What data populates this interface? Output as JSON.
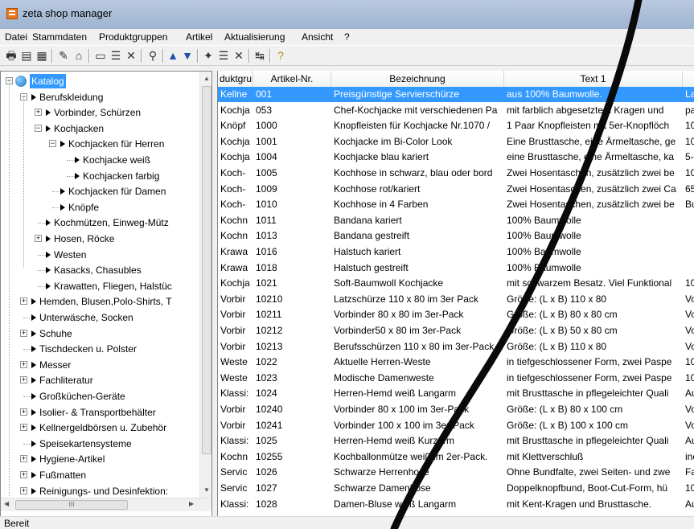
{
  "window": {
    "title": "zeta shop manager"
  },
  "menu": [
    "Datei",
    "Stammdaten",
    "Produktgruppen",
    "Artikel",
    "Aktualisierung",
    "Ansicht",
    "?"
  ],
  "toolbar_icons": [
    "print-icon",
    "print-preview-icon",
    "document-icon",
    "tool-icon",
    "lock-icon",
    "folder-new-icon",
    "properties-icon",
    "delete-icon",
    "binoculars-icon",
    "arrow-up-icon",
    "arrow-down-icon",
    "new-item-icon",
    "properties-icon",
    "delete-icon",
    "sort-icon",
    "help-icon"
  ],
  "tree": [
    {
      "label": "Katalog",
      "level": 0,
      "expander": "minus",
      "selected": true,
      "icon": "katalog"
    },
    {
      "label": "Berufskleidung",
      "level": 1,
      "expander": "minus"
    },
    {
      "label": "Vorbinder, Schürzen",
      "level": 2,
      "expander": "plus"
    },
    {
      "label": "Kochjacken",
      "level": 2,
      "expander": "minus"
    },
    {
      "label": "Kochjacken für Herren",
      "level": 3,
      "expander": "minus"
    },
    {
      "label": "Kochjacke weiß",
      "level": 4,
      "expander": "none"
    },
    {
      "label": "Kochjacken farbig",
      "level": 4,
      "expander": "none"
    },
    {
      "label": "Kochjacken für Damen",
      "level": 3,
      "expander": "none"
    },
    {
      "label": "Knöpfe",
      "level": 3,
      "expander": "none"
    },
    {
      "label": "Kochmützen, Einweg-Mütz",
      "level": 2,
      "expander": "none"
    },
    {
      "label": "Hosen, Röcke",
      "level": 2,
      "expander": "plus"
    },
    {
      "label": "Westen",
      "level": 2,
      "expander": "none"
    },
    {
      "label": "Kasacks, Chasubles",
      "level": 2,
      "expander": "none"
    },
    {
      "label": "Krawatten, Fliegen, Halstüc",
      "level": 2,
      "expander": "none"
    },
    {
      "label": "Hemden, Blusen,Polo-Shirts, T",
      "level": 1,
      "expander": "plus"
    },
    {
      "label": "Unterwäsche, Socken",
      "level": 1,
      "expander": "none"
    },
    {
      "label": "Schuhe",
      "level": 1,
      "expander": "plus"
    },
    {
      "label": "Tischdecken u. Polster",
      "level": 1,
      "expander": "none"
    },
    {
      "label": "Messer",
      "level": 1,
      "expander": "plus"
    },
    {
      "label": "Fachliteratur",
      "level": 1,
      "expander": "plus"
    },
    {
      "label": "Großküchen-Geräte",
      "level": 1,
      "expander": "none"
    },
    {
      "label": "Isolier- & Transportbehälter",
      "level": 1,
      "expander": "plus"
    },
    {
      "label": "Kellnergeldbörsen u. Zubehör",
      "level": 1,
      "expander": "plus"
    },
    {
      "label": "Speisekartensysteme",
      "level": 1,
      "expander": "none"
    },
    {
      "label": "Hygiene-Artikel",
      "level": 1,
      "expander": "plus"
    },
    {
      "label": "Fußmatten",
      "level": 1,
      "expander": "plus"
    },
    {
      "label": "Reinigungs- und Desinfektion:",
      "level": 1,
      "expander": "plus"
    }
  ],
  "tree_hscroll_grip": "III",
  "grid": {
    "columns": [
      "duktgru",
      "Artikel-Nr.",
      "Bezeichnung",
      "Text 1"
    ],
    "rows": [
      [
        "Kellne",
        "001",
        "Preisgünstige Servierschürze",
        "aus 100% Baumwolle.",
        "La"
      ],
      [
        "Kochja",
        "053",
        "Chef-Kochjacke mit verschiedenen Pa",
        "mit farblich abgesetztem Kragen und",
        "pa"
      ],
      [
        "Knöpf",
        "1000",
        "Knopfleisten für Kochjacke Nr.1070 /",
        "1 Paar Knopfleisten mit 5er-Knopflöch",
        "10"
      ],
      [
        "Kochja",
        "1001",
        "Kochjacke im Bi-Color Look",
        "Eine Brusttasche, eine Ärmeltasche, ge",
        "10"
      ],
      [
        "Kochja",
        "1004",
        "Kochjacke blau kariert",
        "eine Brusttasche, eine Ärmeltasche, ka",
        "5-"
      ],
      [
        "Koch-",
        "1005",
        "Kochhose in schwarz, blau oder bord",
        "Zwei Hosentaschen, zusätzlich zwei be",
        "10"
      ],
      [
        "Koch-",
        "1009",
        "Kochhose rot/kariert",
        "Zwei Hosentaschen, zusätzlich zwei Ca",
        "65"
      ],
      [
        "Koch-",
        "1010",
        "Kochhose in 4 Farben",
        "Zwei Hosentaschen, zusätzlich zwei be",
        "Bu"
      ],
      [
        "Kochn",
        "1011",
        "Bandana kariert",
        "100% Baumwolle",
        ""
      ],
      [
        "Kochn",
        "1013",
        "Bandana gestreift",
        "100% Baumwolle",
        ""
      ],
      [
        "Krawa",
        "1016",
        "Halstuch kariert",
        "100% Baumwolle",
        ""
      ],
      [
        "Krawa",
        "1018",
        "Halstuch gestreift",
        "100% Baumwolle",
        ""
      ],
      [
        "Kochja",
        "1021",
        "Soft-Baumwoll Kochjacke",
        "mit schwarzem Besatz. Viel Funktional",
        "10"
      ],
      [
        "Vorbir",
        "10210",
        "Latzschürze 110 x 80 im 3er Pack",
        "Größe: (L x B) 110 x 80",
        "Vo"
      ],
      [
        "Vorbir",
        "10211",
        "Vorbinder 80 x 80 im 3er-Pack",
        "Größe: (L x B) 80 x 80 cm",
        "Vo"
      ],
      [
        "Vorbir",
        "10212",
        "Vorbinder50 x 80 im 3er-Pack",
        "Größe: (L x B) 50 x 80 cm",
        "Vo"
      ],
      [
        "Vorbir",
        "10213",
        "Berufsschürzen 110 x 80 im 3er-Pack",
        "Größe: (L x B) 110 x 80",
        "Vo"
      ],
      [
        "Weste",
        "1022",
        "Aktuelle Herren-Weste",
        "in tiefgeschlossener Form, zwei Paspe",
        "10"
      ],
      [
        "Weste",
        "1023",
        "Modische Damenweste",
        "in tiefgeschlossener Form, zwei Paspe",
        "10"
      ],
      [
        "Klassi:",
        "1024",
        "Herren-Hemd weiß Langarm",
        "mit Brusttasche in pflegeleichter Quali",
        "Au"
      ],
      [
        "Vorbir",
        "10240",
        "Vorbinder 80 x 100 im 3er-Pack",
        "Größe: (L x B) 80 x 100 cm",
        "Vo"
      ],
      [
        "Vorbir",
        "10241",
        "Vorbinder 100 x 100 im 3er-Pack",
        "Größe: (L x B) 100 x 100 cm",
        "Vo"
      ],
      [
        "Klassi:",
        "1025",
        "Herren-Hemd weiß Kurzarm",
        "mit Brusttasche in pflegeleichter Quali",
        "Au"
      ],
      [
        "Kochn",
        "10255",
        "Kochballonmütze weiß im 2er-Pack.",
        "mit Klettverschluß",
        "inc"
      ],
      [
        "Servic",
        "1026",
        "Schwarze Herrenhose",
        "Ohne Bundfalte, zwei Seiten- und zwe",
        "Fa"
      ],
      [
        "Servic",
        "1027",
        "Schwarze Damenhose",
        "Doppelknopfbund, Boot-Cut-Form, hü",
        "10"
      ],
      [
        "Klassi:",
        "1028",
        "Damen-Bluse weiß Langarm",
        "mit Kent-Kragen und Brusttasche.",
        "Au"
      ]
    ]
  },
  "status": "Bereit",
  "colors": {
    "selection": "#3399ff",
    "titlebar": "#a8bcd6",
    "background": "#7a0a12"
  }
}
